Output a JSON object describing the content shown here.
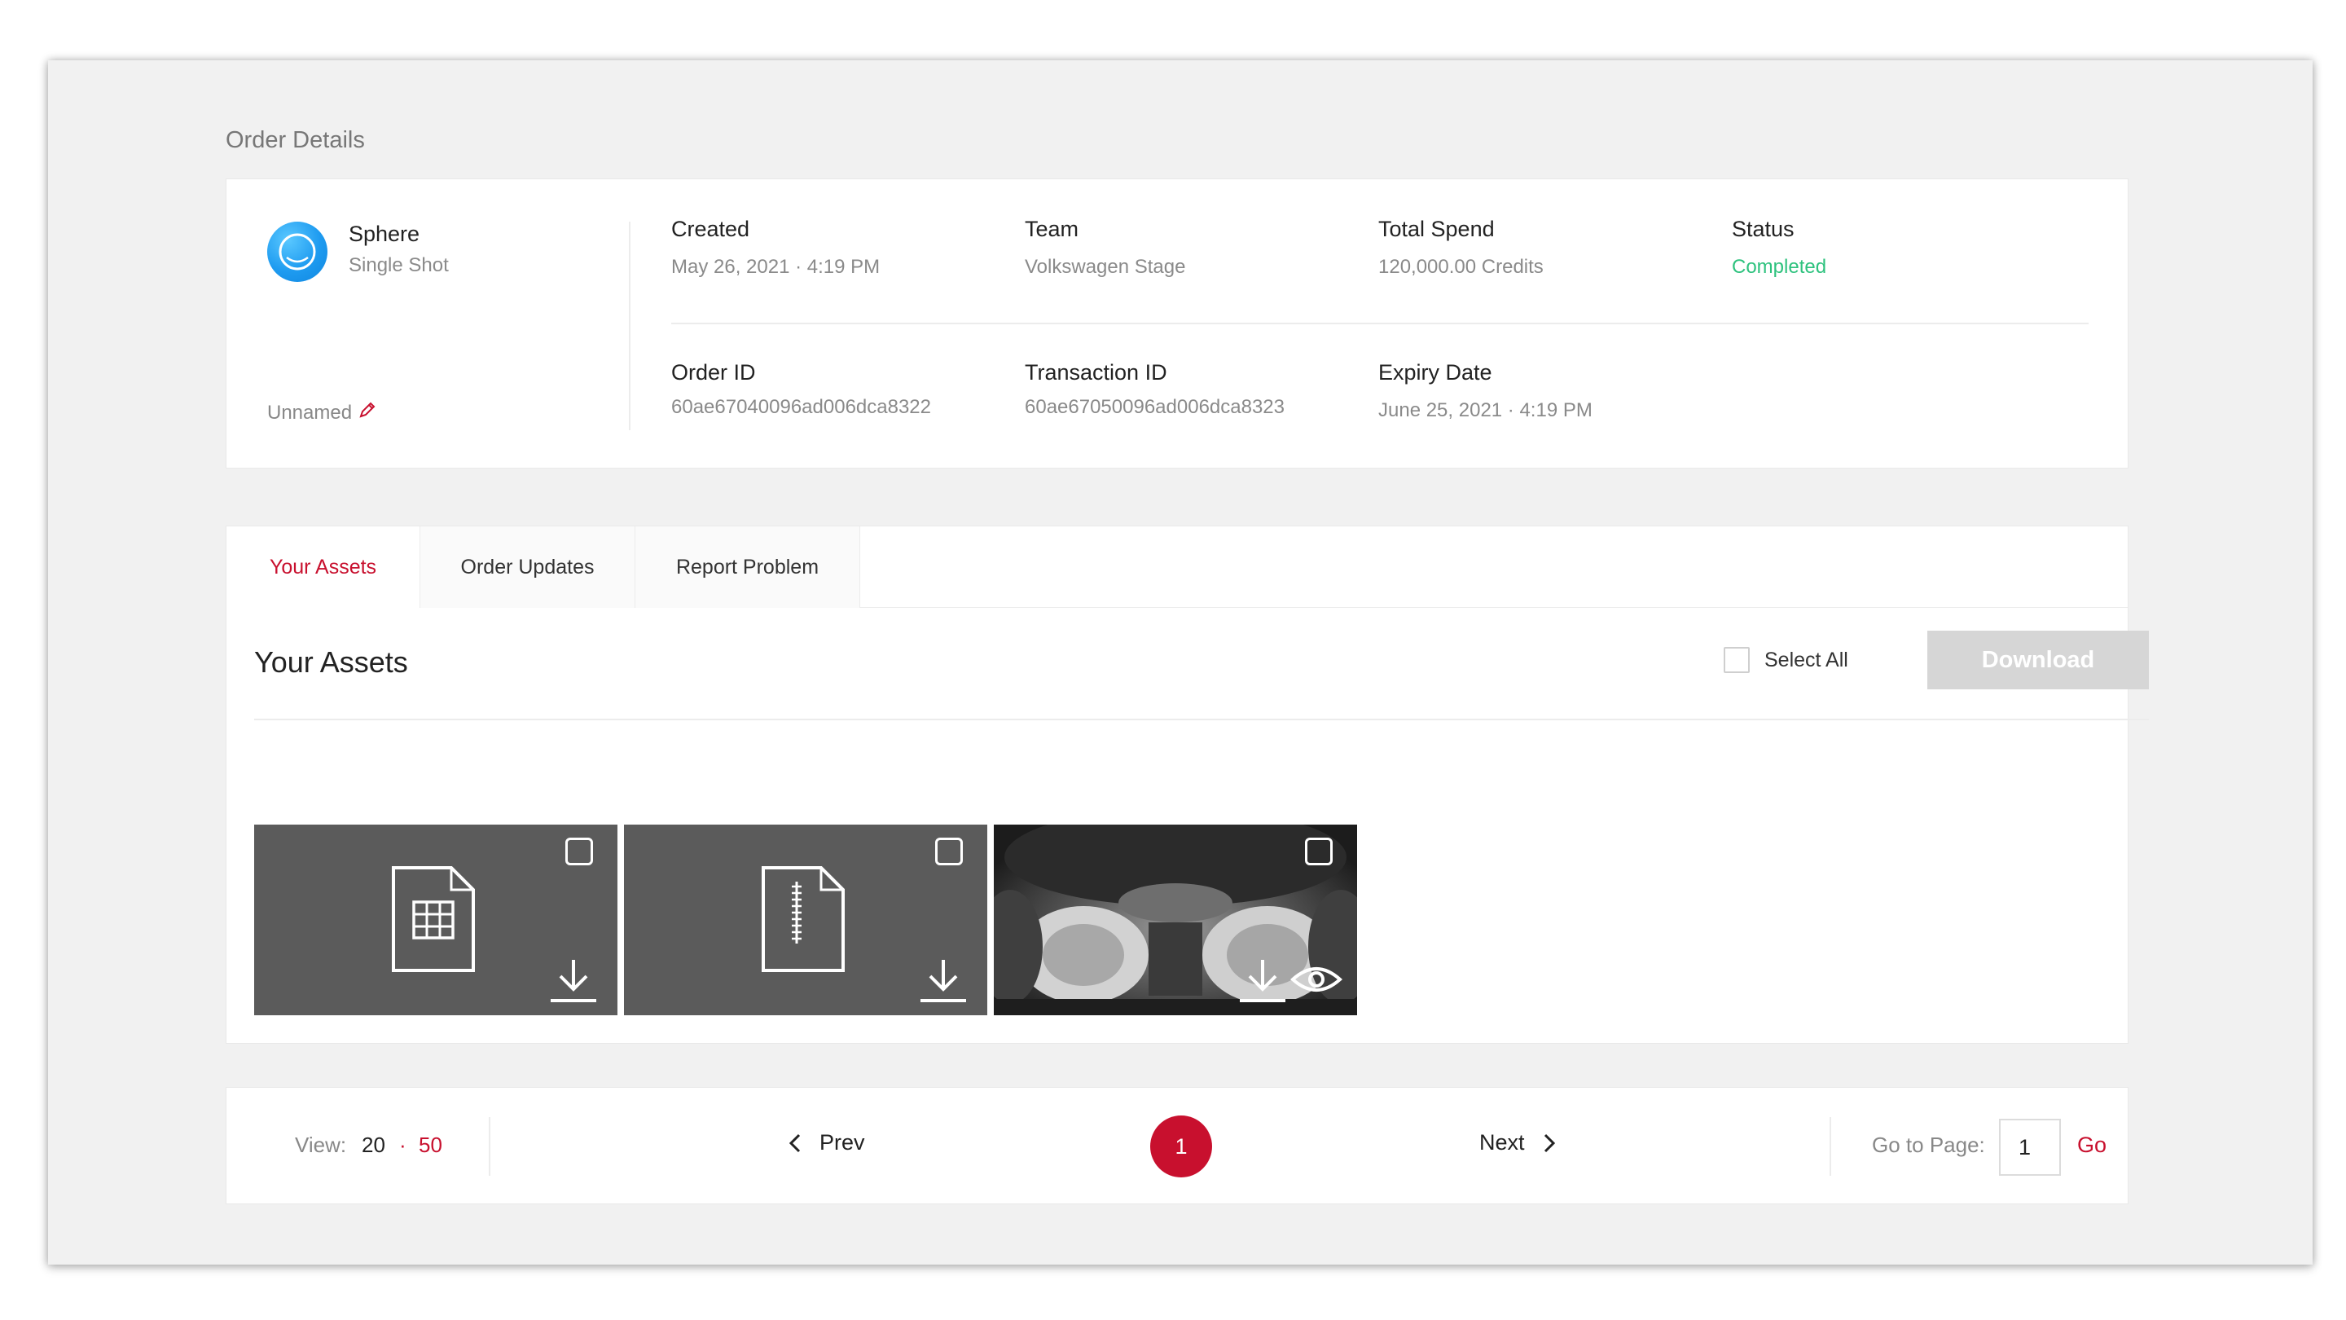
{
  "page": {
    "title": "Order Details"
  },
  "order": {
    "product_name": "Sphere",
    "product_type": "Single Shot",
    "name_placeholder": "Unnamed",
    "fields": {
      "created_label": "Created",
      "created_value": "May 26, 2021 · 4:19 PM",
      "team_label": "Team",
      "team_value": "Volkswagen Stage",
      "spend_label": "Total Spend",
      "spend_value": "120,000.00 Credits",
      "status_label": "Status",
      "status_value": "Completed",
      "order_id_label": "Order ID",
      "order_id_value": "60ae67040096ad006dca8322",
      "transaction_label": "Transaction ID",
      "transaction_value": "60ae67050096ad006dca8323",
      "expiry_label": "Expiry Date",
      "expiry_value": "June 25, 2021 · 4:19 PM"
    },
    "colors": {
      "status_completed": "#2ec27e",
      "product_icon": "#1e9bf0",
      "edit_icon": "#c8102e"
    }
  },
  "tabs": [
    {
      "label": "Your Assets",
      "active": true
    },
    {
      "label": "Order Updates",
      "active": false
    },
    {
      "label": "Report Problem",
      "active": false
    }
  ],
  "assets": {
    "heading": "Your Assets",
    "select_all_label": "Select All",
    "download_label": "Download",
    "tiles": [
      {
        "kind": "spreadsheet-file",
        "icons": [
          "spreadsheet-file-icon",
          "download-icon"
        ]
      },
      {
        "kind": "zip-file",
        "icons": [
          "zip-file-icon",
          "download-icon"
        ]
      },
      {
        "kind": "360-photo",
        "icons": [
          "download-icon",
          "eye-icon"
        ]
      }
    ]
  },
  "pagination": {
    "view_label": "View:",
    "view_option_20": "20",
    "view_separator": "·",
    "view_option_50": "50",
    "prev_label": "Prev",
    "current_page": "1",
    "next_label": "Next",
    "goto_label": "Go to Page:",
    "goto_value": "1",
    "go_label": "Go"
  },
  "theme": {
    "accent": "#c8102e",
    "disabled_button": "#d6d6d6"
  }
}
